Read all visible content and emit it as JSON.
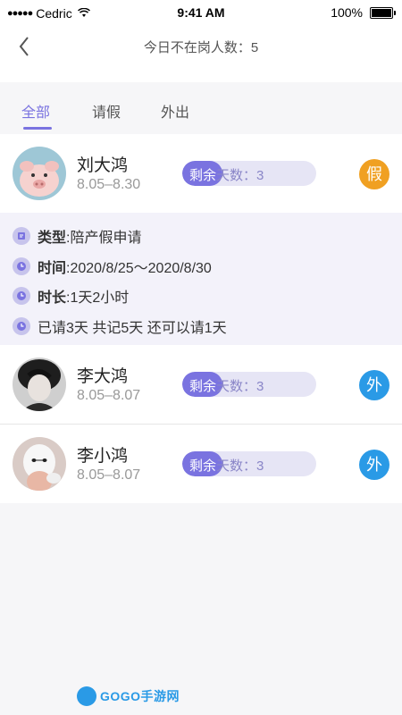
{
  "status_bar": {
    "carrier": "Cedric",
    "time": "9:41 AM",
    "battery": "100%"
  },
  "nav": {
    "title": "今日不在岗人数：5"
  },
  "tabs": [
    {
      "label": "全部",
      "active": true
    },
    {
      "label": "请假",
      "active": false
    },
    {
      "label": "外出",
      "active": false
    }
  ],
  "people": [
    {
      "name": "刘大鸿",
      "dates": "8.05–8.30",
      "remain_label": "剩余天数：3",
      "remain_prefix": "剩余",
      "remain_rest": "天数：3",
      "remain_fraction": 0.3,
      "badge": "假",
      "badge_color": "#f0a022"
    },
    {
      "name": "李大鸿",
      "dates": "8.05–8.07",
      "remain_label": "剩余天数：3",
      "remain_prefix": "剩余",
      "remain_rest": "天数：3",
      "remain_fraction": 0.3,
      "badge": "外",
      "badge_color": "#2a9ae6"
    },
    {
      "name": "李小鸿",
      "dates": "8.05–8.07",
      "remain_label": "剩余天数：3",
      "remain_prefix": "剩余",
      "remain_rest": "天数：3",
      "remain_fraction": 0.3,
      "badge": "外",
      "badge_color": "#2a9ae6"
    }
  ],
  "details": {
    "type_label": "类型",
    "type_value": ":陪产假申请",
    "time_label": "时间",
    "time_value": ":2020/8/25～2020/8/30",
    "duration_label": "时长",
    "duration_value": ":1天2小时",
    "summary": "已请3天 共记5天 还可以请1天"
  },
  "watermark": {
    "text": "GOGO手游网"
  },
  "colors": {
    "accent": "#7a73e0",
    "leave": "#f0a022",
    "out": "#2a9ae6"
  }
}
